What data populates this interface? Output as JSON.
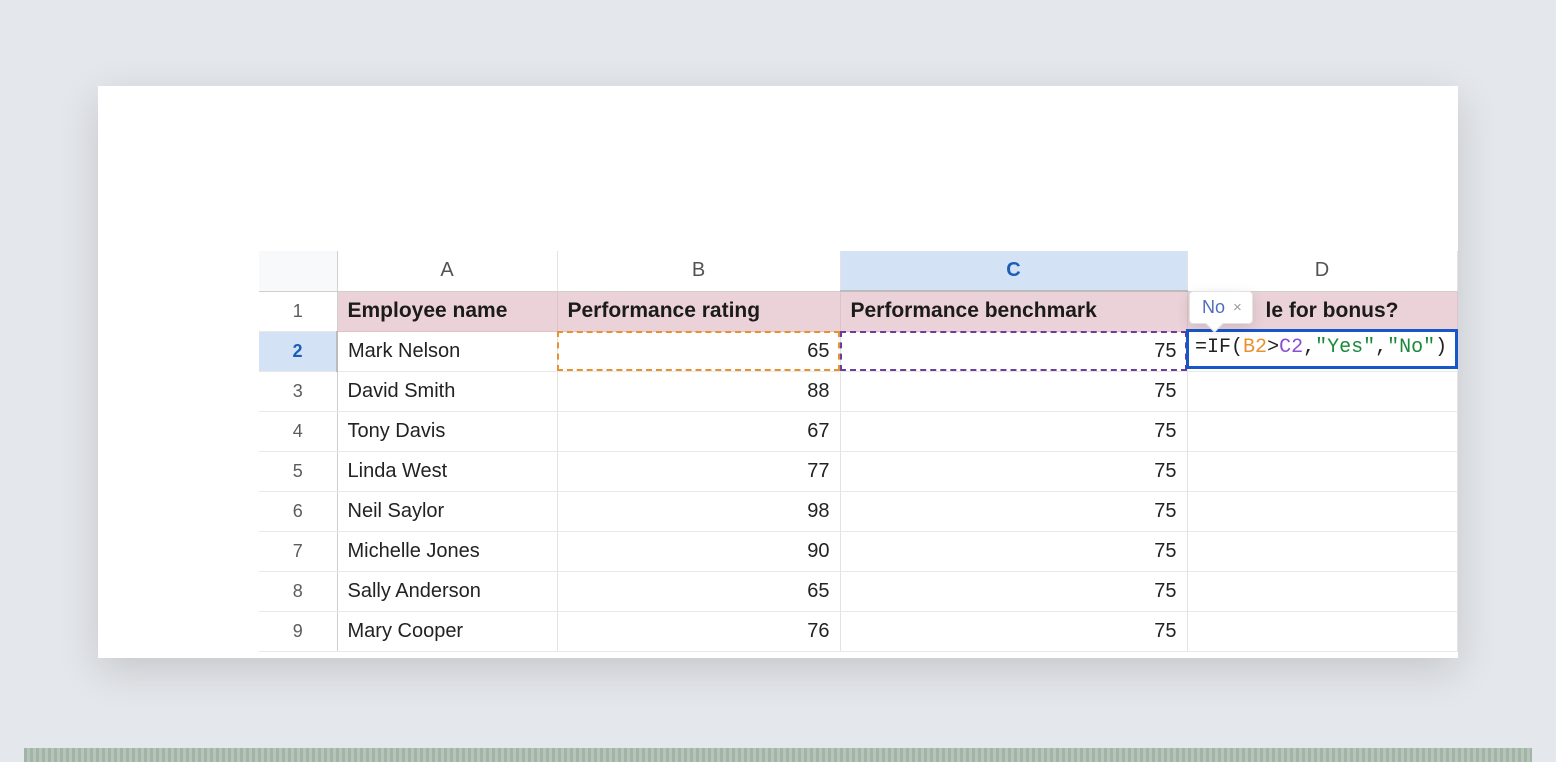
{
  "columns": {
    "A": "A",
    "B": "B",
    "C": "C",
    "D": "D"
  },
  "active_col": "C",
  "active_row": "2",
  "headers": {
    "A": "Employee name",
    "B": "Performance rating",
    "C": "Performance benchmark",
    "D_visible_fragment": "le for bonus?",
    "D_full": "Eligible for bonus?"
  },
  "rows": [
    {
      "n": "1"
    },
    {
      "n": "2",
      "name": "Mark Nelson",
      "rating": "65",
      "benchmark": "75"
    },
    {
      "n": "3",
      "name": "David Smith",
      "rating": "88",
      "benchmark": "75"
    },
    {
      "n": "4",
      "name": "Tony Davis",
      "rating": "67",
      "benchmark": "75"
    },
    {
      "n": "5",
      "name": "Linda West",
      "rating": "77",
      "benchmark": "75"
    },
    {
      "n": "6",
      "name": "Neil Saylor",
      "rating": "98",
      "benchmark": "75"
    },
    {
      "n": "7",
      "name": "Michelle Jones",
      "rating": "90",
      "benchmark": "75"
    },
    {
      "n": "8",
      "name": "Sally Anderson",
      "rating": "65",
      "benchmark": "75"
    },
    {
      "n": "9",
      "name": "Mary Cooper",
      "rating": "76",
      "benchmark": "75"
    }
  ],
  "formula": {
    "raw": "=IF(B2>C2,\"Yes\",\"No\")",
    "eq": "=",
    "fn": "IF",
    "open": "(",
    "refB": "B2",
    "op": ">",
    "refC": "C2",
    "c1": ",",
    "str1": "\"Yes\"",
    "c2": ",",
    "str2": "\"No\"",
    "close": ")"
  },
  "tooltip": {
    "value": "No",
    "close": "×"
  },
  "colors": {
    "header_fill": "#ead2d8",
    "selection_fill": "#d4e2f5",
    "formula_border": "#1857c8",
    "ref_b_color": "#e8912f",
    "ref_c_color": "#6a3ea1",
    "string_color": "#1a8a3a"
  }
}
